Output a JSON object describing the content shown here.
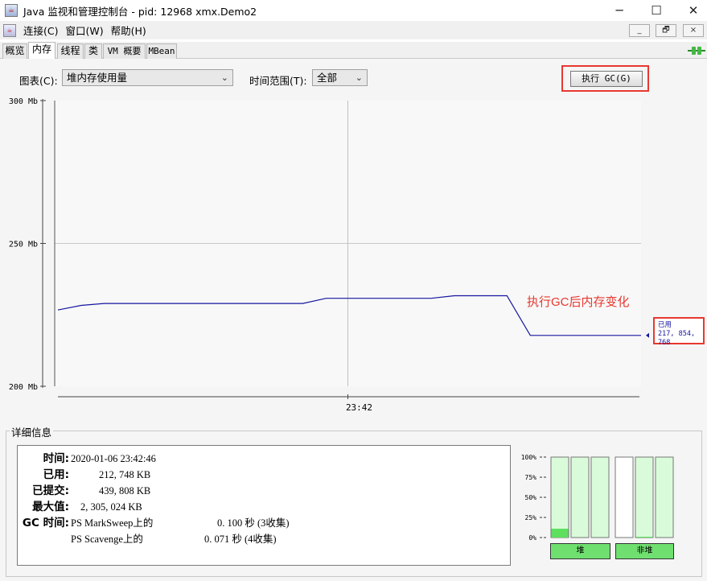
{
  "window": {
    "title": "Java 监视和管理控制台 - pid: 12968 xmx.Demo2",
    "minimize": "─",
    "maximize": "☐",
    "close": "✕",
    "app_icon": "☕"
  },
  "menu": {
    "java_icon": "☕",
    "items": [
      "连接(C)",
      "窗口(W)",
      "帮助(H)"
    ],
    "mdi_buttons": [
      "_",
      "🗗",
      "×"
    ]
  },
  "tabs": [
    "概览",
    "内存",
    "线程",
    "类",
    "VM 概要",
    "MBean"
  ],
  "active_tab": "内存",
  "controls": {
    "chart_label": "图表(C):",
    "chart_value": "堆内存使用量",
    "range_label": "时间范围(T):",
    "range_value": "全部",
    "arrow": "⌄",
    "gc_button": "执行 GC(G)"
  },
  "annotation": "执行GC后内存变化",
  "used_tag": {
    "label": "已用",
    "value": "217, 854, 768"
  },
  "chart_data": {
    "type": "line",
    "yticks": [
      "300 Mb",
      "250 Mb",
      "200 Mb"
    ],
    "ylim": [
      200,
      300
    ],
    "xtick": "23:42",
    "grid": true,
    "series": [
      {
        "color": "#1515a0",
        "points": [
          [
            0,
            226.7
          ],
          [
            0.04,
            228.3
          ],
          [
            0.08,
            229.0
          ],
          [
            0.42,
            229.0
          ],
          [
            0.46,
            230.8
          ],
          [
            0.64,
            230.8
          ],
          [
            0.68,
            231.7
          ],
          [
            0.77,
            231.7
          ],
          [
            0.81,
            217.8
          ],
          [
            1.0,
            217.8
          ]
        ]
      }
    ],
    "crosshair_x": 0.5
  },
  "details": {
    "title": "详细信息",
    "rows": [
      {
        "label": "时间:",
        "value": "2020-01-06 23:42:46"
      },
      {
        "label": "已用:",
        "value": "212, 748 KB"
      },
      {
        "label": "已提交:",
        "value": "439, 808 KB"
      },
      {
        "label": "最大值:",
        "value": "2, 305, 024 KB"
      },
      {
        "label": "GC 时间:",
        "value": "PS MarkSweep上的",
        "value2": "0. 100 秒 (3收集)"
      },
      {
        "label": "",
        "value": "PS Scavenge上的",
        "value2": "0. 071 秒 (4收集)"
      }
    ]
  },
  "pools": {
    "ticks": [
      "100%",
      "75%",
      "50%",
      "25%",
      "0%"
    ],
    "heap_levels": [
      0.11,
      0,
      0
    ],
    "nonheap_levels": [
      0,
      0.01,
      0
    ],
    "heap_label": "堆",
    "nonheap_label": "非堆",
    "fill_color": "#5ee05e",
    "empty_color": "#d9fbd9"
  }
}
